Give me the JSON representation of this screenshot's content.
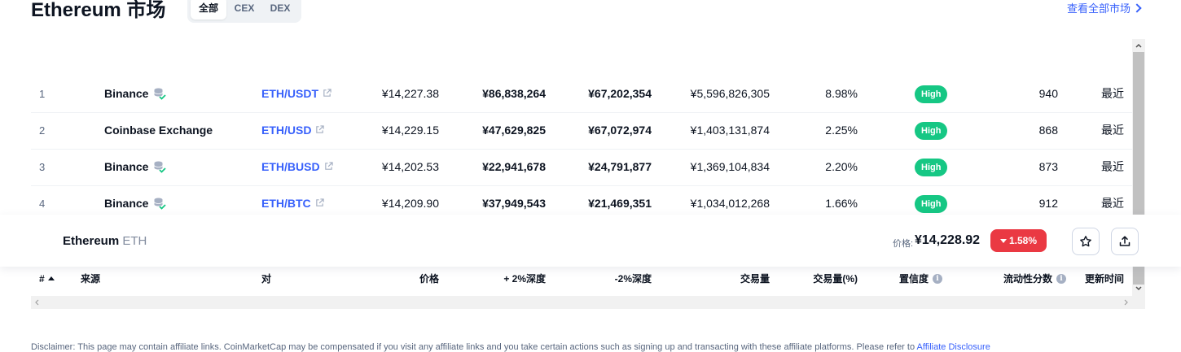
{
  "header": {
    "title": "Ethereum 市场",
    "tabs": [
      {
        "label": "全部",
        "active": true
      },
      {
        "label": "CEX",
        "active": false
      },
      {
        "label": "DEX",
        "active": false
      }
    ],
    "view_all": "查看全部市场"
  },
  "table": {
    "columns": {
      "rank": "#",
      "source": "来源",
      "pair": "对",
      "price": "价格",
      "plus_depth": "+ 2%深度",
      "minus_depth": "-2%深度",
      "volume": "交易量",
      "volume_pct": "交易量(%)",
      "confidence": "置信度",
      "liquidity": "流动性分数",
      "updated": "更新时间"
    },
    "rows": [
      {
        "rank": "1",
        "source": "Binance",
        "pair": "ETH/USDT",
        "price": "¥14,227.38",
        "plus_depth": "¥86,838,264",
        "minus_depth": "¥67,202,354",
        "volume": "¥5,596,826,305",
        "volume_pct": "8.98%",
        "confidence": "High",
        "liquidity": "940",
        "updated": "最近"
      },
      {
        "rank": "2",
        "source": "Coinbase Exchange",
        "pair": "ETH/USD",
        "price": "¥14,229.15",
        "plus_depth": "¥47,629,825",
        "minus_depth": "¥67,072,974",
        "volume": "¥1,403,131,874",
        "volume_pct": "2.25%",
        "confidence": "High",
        "liquidity": "868",
        "updated": "最近"
      },
      {
        "rank": "3",
        "source": "Binance",
        "pair": "ETH/BUSD",
        "price": "¥14,202.53",
        "plus_depth": "¥22,941,678",
        "minus_depth": "¥24,791,877",
        "volume": "¥1,369,104,834",
        "volume_pct": "2.20%",
        "confidence": "High",
        "liquidity": "873",
        "updated": "最近"
      },
      {
        "rank": "4",
        "source": "Binance",
        "pair": "ETH/BTC",
        "price": "¥14,209.90",
        "plus_depth": "¥37,949,543",
        "minus_depth": "¥21,469,351",
        "volume": "¥1,034,012,268",
        "volume_pct": "1.66%",
        "confidence": "High",
        "liquidity": "912",
        "updated": "最近"
      }
    ]
  },
  "sticky": {
    "name": "Ethereum",
    "symbol": "ETH",
    "price_label": "价格:",
    "price": "¥14,228.92",
    "change": "1.58%",
    "change_direction": "down"
  },
  "disclaimer": {
    "text": "Disclaimer: This page may contain affiliate links. CoinMarketCap may be compensated if you visit any affiliate links and you take certain actions such as signing up and transacting with these affiliate platforms. Please refer to ",
    "link": "Affiliate Disclosure"
  },
  "colors": {
    "accent": "#3861fb",
    "high": "#16c784",
    "down": "#ea3943"
  }
}
